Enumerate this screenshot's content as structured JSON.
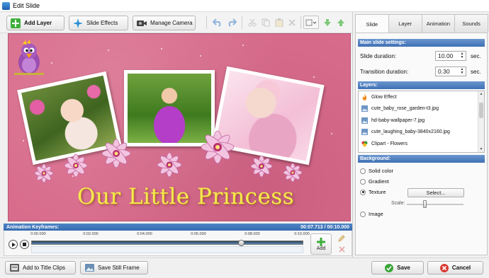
{
  "window": {
    "title": "Edit Slide"
  },
  "toolbar": {
    "add_layer": "Add Layer",
    "slide_effects": "Slide Effects",
    "manage_camera": "Manage Camera"
  },
  "preview": {
    "headline": "Our Little Princess"
  },
  "animation": {
    "header": "Animation Keyframes:",
    "time_readout": "00:07.713 / 00:10.000",
    "ticks": [
      "0:00.000",
      "0:02.000",
      "0:04.000",
      "0:05.000",
      "0:08.000",
      "0:10.000"
    ],
    "add_label": "Add"
  },
  "bottom": {
    "add_to_title_clips": "Add to Title Clips",
    "save_still_frame": "Save Still Frame",
    "save": "Save",
    "cancel": "Cancel"
  },
  "panel": {
    "tabs": [
      "Slide",
      "Layer",
      "Animation",
      "Sounds"
    ],
    "main_settings_header": "Main slide settings:",
    "slide_duration_label": "Slide duration:",
    "slide_duration_value": "10.00",
    "transition_duration_label": "Transition duration:",
    "transition_duration_value": "0.30",
    "unit": "sec.",
    "layers_header": "Layers:",
    "layers": [
      {
        "name": "Glow Effect",
        "icon": "flame-icon"
      },
      {
        "name": "cute_baby_rose_garden-t3.jpg",
        "icon": "image-icon"
      },
      {
        "name": "hd-baby-wallpaper-7.jpg",
        "icon": "image-icon"
      },
      {
        "name": "cute_laughing_baby-3840x2160.jpg",
        "icon": "image-icon"
      },
      {
        "name": "Clipart - Flowers",
        "icon": "clipart-icon"
      }
    ],
    "background_header": "Background:",
    "bg_options": [
      "Solid color",
      "Gradient",
      "Texture",
      "Image"
    ],
    "bg_selected": "Texture",
    "select_label": "Select...",
    "scale_label": "Scale:"
  },
  "colors": {
    "slide_bg": "#d86c8c",
    "headline": "#f5ea50",
    "header_blue": "#3f70b4"
  }
}
